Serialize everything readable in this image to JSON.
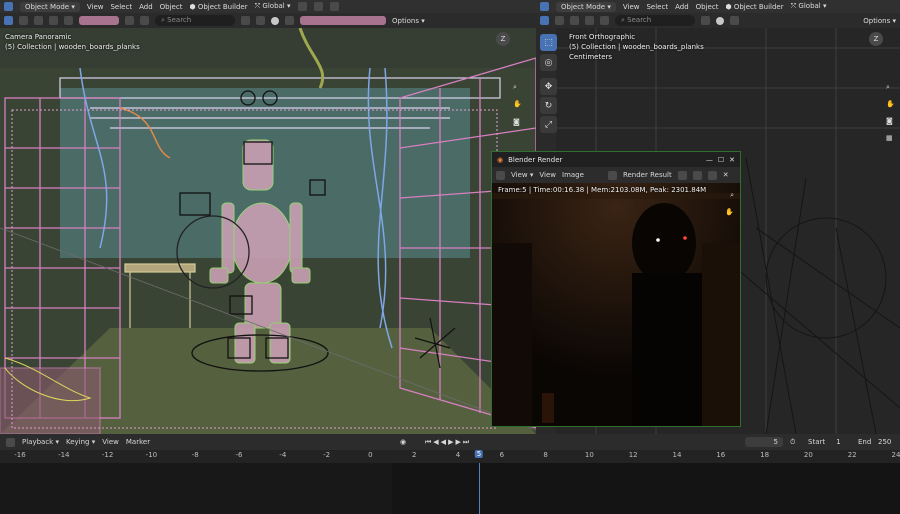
{
  "left_header": {
    "mode": "Object Mode",
    "menus": [
      "View",
      "Select",
      "Add",
      "Object"
    ],
    "builder": "Object Builder",
    "transform": "Global",
    "search_placeholder": "Search",
    "options": "Options"
  },
  "right_header": {
    "mode": "Object Mode",
    "menus": [
      "View",
      "Select",
      "Add",
      "Object"
    ],
    "builder": "Object Builder",
    "transform": "Global",
    "search_placeholder": "Search",
    "options": "Options"
  },
  "left_viewport": {
    "view_name": "Camera Panoramic",
    "collection": "(5) Collection | wooden_boards_planks",
    "nav_gizmo_label": "Z"
  },
  "right_viewport": {
    "view_name": "Front Orthographic",
    "collection": "(5) Collection | wooden_boards_planks",
    "units": "Centimeters",
    "nav_gizmo_label": "Z",
    "tools": [
      "select-box-icon",
      "cursor-icon",
      "move-icon",
      "rotate-icon",
      "scale-icon"
    ]
  },
  "render_window": {
    "title": "Blender Render",
    "menus": [
      "View",
      "View",
      "Image"
    ],
    "slot": "Render Result",
    "info": "Frame:5 | Time:00:16.38 | Mem:2103.08M, Peak: 2301.84M"
  },
  "timeline": {
    "menus": [
      "Playback",
      "Keying",
      "View",
      "Marker"
    ],
    "current_frame": "5",
    "start_label": "Start",
    "start": "1",
    "end_label": "End",
    "end": "250",
    "ticks": [
      "-16",
      "-14",
      "-12",
      "-10",
      "-8",
      "-6",
      "-4",
      "-2",
      "0",
      "2",
      "4",
      "6",
      "8",
      "10",
      "12",
      "14",
      "16",
      "18",
      "20",
      "22",
      "24"
    ],
    "frame_marker": "5"
  },
  "colors": {
    "accent": "#4772b3",
    "wire_pink": "#d67fc1",
    "wire_blue": "#7fa6e6",
    "wire_green": "#9fe07a",
    "render_border": "#2f6e2f"
  }
}
